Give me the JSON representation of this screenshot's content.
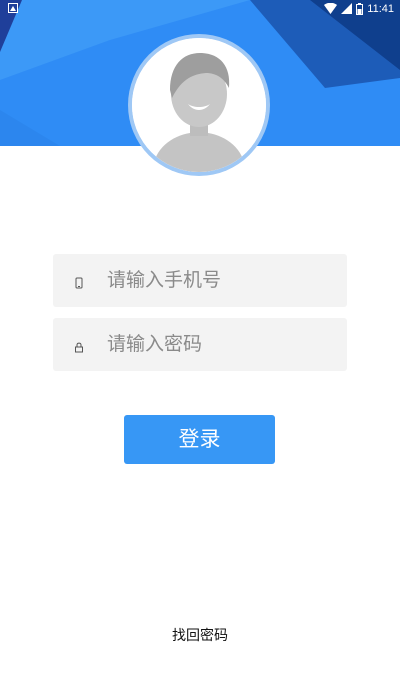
{
  "status_bar": {
    "time": "11:41"
  },
  "colors": {
    "header_blue": "#2f8cf5",
    "header_dark": "#1e4fa8",
    "button_blue": "#3797f5",
    "field_bg": "#f3f3f3"
  },
  "header": {
    "avatar_icon": "default-user-avatar-icon"
  },
  "form": {
    "phone_placeholder": "请输入手机号",
    "phone_icon": "phone-icon",
    "password_placeholder": "请输入密码",
    "password_icon": "lock-icon"
  },
  "actions": {
    "login_label": "登录",
    "forgot_label": "找回密码"
  }
}
